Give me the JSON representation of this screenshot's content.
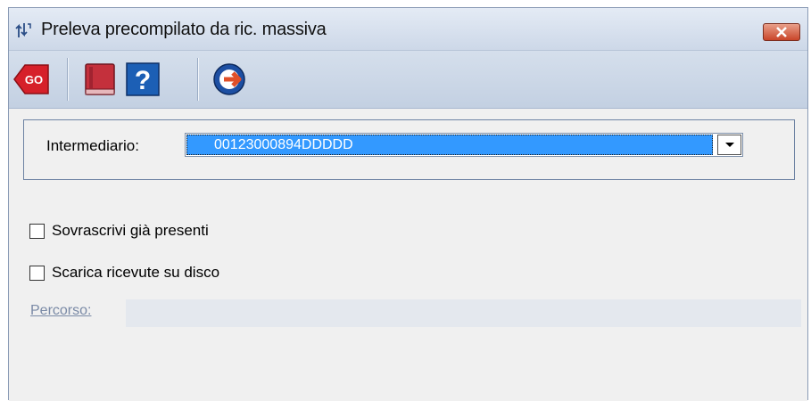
{
  "window": {
    "title": "Preleva precompilato da ric. massiva",
    "title_icon": "transfer-arrows-icon",
    "close_icon": "close-icon"
  },
  "toolbar": {
    "buttons": [
      {
        "icon": "go-icon",
        "label": "GO"
      },
      {
        "icon": "book-icon"
      },
      {
        "icon": "help-icon",
        "label": "?"
      },
      {
        "icon": "exit-icon"
      }
    ]
  },
  "form": {
    "intermediario_label": "Intermediario:",
    "intermediario_value": "00123000894DDDDD",
    "overwrite_label": "Sovrascrivi già presenti",
    "overwrite_checked": false,
    "download_label": "Scarica ricevute su disco",
    "download_checked": false,
    "percorso_label": "Percorso:",
    "percorso_value": ""
  },
  "colors": {
    "selection": "#3399ff",
    "close_button": "#c9462a",
    "go_red": "#d6202a",
    "help_blue": "#1c5fb5"
  }
}
